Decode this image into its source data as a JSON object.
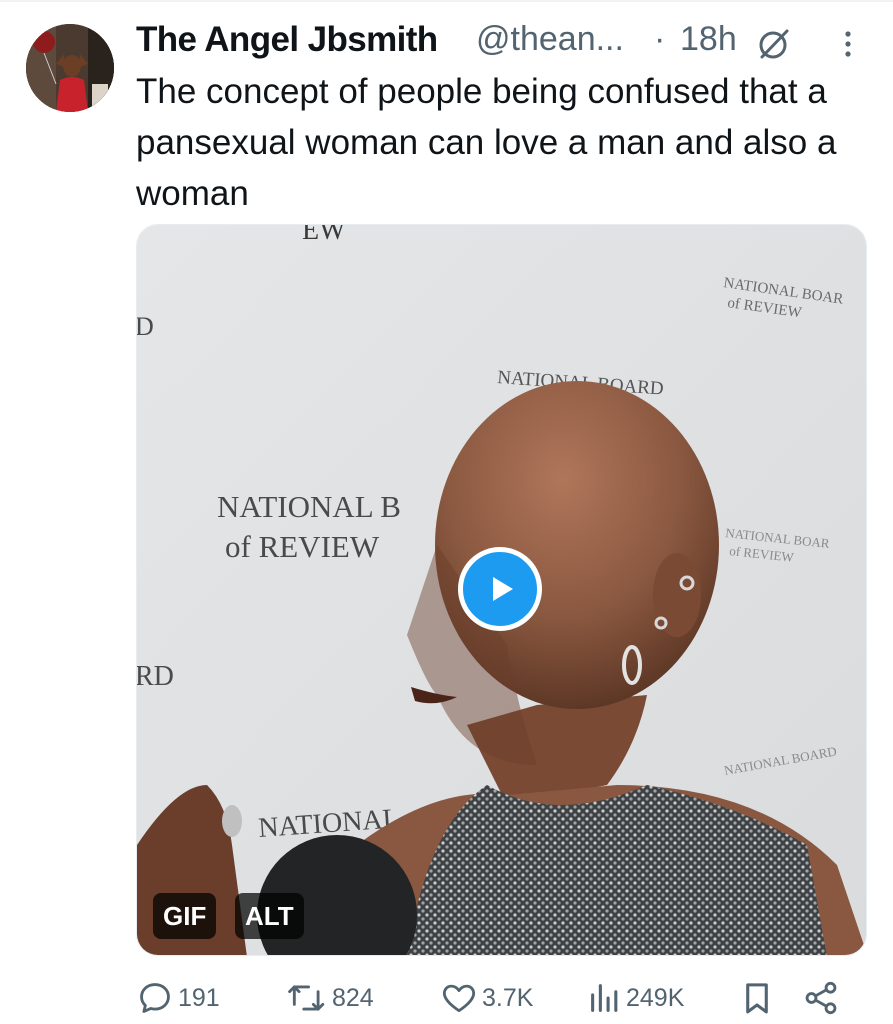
{
  "tweet": {
    "display_name": "The Angel Jbsmith",
    "handle": "@thean...",
    "separator": "·",
    "time": "18h",
    "text": "The concept of people being confused that a pansexual woman can love a man and also a woman"
  },
  "media": {
    "backdrop_texts": {
      "top_fragment": "EW",
      "top_right": [
        "NATIONAL BOAR",
        "of REVIEW"
      ],
      "center": "NATIONAL BOARD",
      "left_line1": "NATIONAL B",
      "left_line2": "of REVIEW",
      "right_line1": "NATIONAL BOAR",
      "right_line2": "of REVIEW",
      "bottom": "NATIONAL",
      "bottom_right": "NATIONAL BOARD",
      "left_edge_top": "D",
      "left_edge_bottom": "RD"
    },
    "badges": {
      "gif": "GIF",
      "alt": "ALT"
    },
    "play_icon": "play-icon"
  },
  "actions": {
    "reply_count": "191",
    "retweet_count": "824",
    "like_count": "3.7K",
    "views_count": "249K"
  },
  "colors": {
    "text_primary": "#0f1419",
    "text_secondary": "#536471",
    "accent_blue": "#1d9bf0",
    "border": "#eff3f4"
  }
}
